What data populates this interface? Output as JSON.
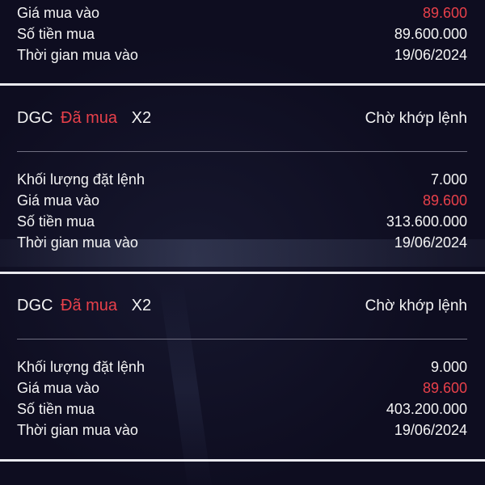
{
  "labels": {
    "order_volume": "Khối lượng đặt lệnh",
    "buy_price": "Giá mua vào",
    "buy_amount": "Số tiền mua",
    "buy_time": "Thời gian mua vào"
  },
  "partial_top": {
    "buy_price": "89.600",
    "buy_amount": "89.600.000",
    "buy_time": "19/06/2024"
  },
  "orders": [
    {
      "ticker": "DGC",
      "status": "Đã mua",
      "multiplier": "X2",
      "state": "Chờ khớp lệnh",
      "volume": "7.000",
      "price": "89.600",
      "amount": "313.600.000",
      "time": "19/06/2024"
    },
    {
      "ticker": "DGC",
      "status": "Đã mua",
      "multiplier": "X2",
      "state": "Chờ khớp lệnh",
      "volume": "9.000",
      "price": "89.600",
      "amount": "403.200.000",
      "time": "19/06/2024"
    }
  ],
  "colors": {
    "background": "#0e0d20",
    "accent_red": "#e8404a",
    "text": "#f4f4f4"
  }
}
